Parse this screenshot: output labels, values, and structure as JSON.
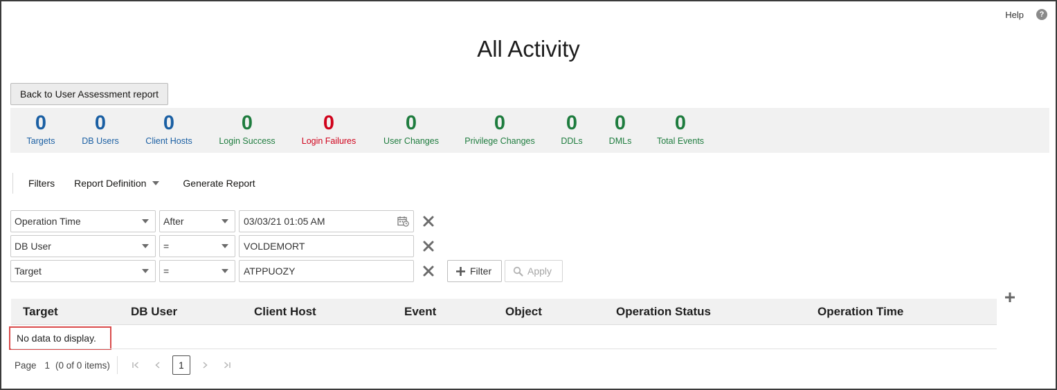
{
  "header": {
    "help_label": "Help",
    "help_icon": "help-circle-icon",
    "title": "All Activity"
  },
  "back_button_label": "Back to User Assessment report",
  "summary": {
    "metrics": [
      {
        "value": "0",
        "label": "Targets",
        "color": "#1a5fa3"
      },
      {
        "value": "0",
        "label": "DB Users",
        "color": "#1a5fa3"
      },
      {
        "value": "0",
        "label": "Client Hosts",
        "color": "#1a5fa3"
      },
      {
        "value": "0",
        "label": "Login Success",
        "color": "#1e7c3e"
      },
      {
        "value": "0",
        "label": "Login Failures",
        "color": "#d0021b"
      },
      {
        "value": "0",
        "label": "User Changes",
        "color": "#1e7c3e"
      },
      {
        "value": "0",
        "label": "Privilege Changes",
        "color": "#1e7c3e"
      },
      {
        "value": "0",
        "label": "DDLs",
        "color": "#1e7c3e"
      },
      {
        "value": "0",
        "label": "DMLs",
        "color": "#1e7c3e"
      },
      {
        "value": "0",
        "label": "Total Events",
        "color": "#1e7c3e"
      }
    ]
  },
  "toolbar": {
    "filters_label": "Filters",
    "report_definition_label": "Report Definition",
    "generate_report_label": "Generate Report"
  },
  "filters": [
    {
      "field": "Operation Time",
      "operator": "After",
      "value": "03/03/21 01:05 AM"
    },
    {
      "field": "DB User",
      "operator": "=",
      "value": "VOLDEMORT"
    },
    {
      "field": "Target",
      "operator": "=",
      "value": "ATPPUOZY"
    }
  ],
  "filter_button_label": "Filter",
  "apply_button_label": "Apply",
  "table": {
    "columns": [
      "Target",
      "DB User",
      "Client Host",
      "Event",
      "Object",
      "Operation Status",
      "Operation Time"
    ],
    "empty_message": "No data to display."
  },
  "pager": {
    "page_label": "Page",
    "page_number": "1",
    "items_summary": "(0 of 0 items)",
    "current_page": "1"
  },
  "colors": {
    "accent_blue": "#1a5fa3",
    "success_green": "#1e7c3e",
    "failure_red": "#d0021b",
    "highlight_border": "#d94a4a"
  }
}
